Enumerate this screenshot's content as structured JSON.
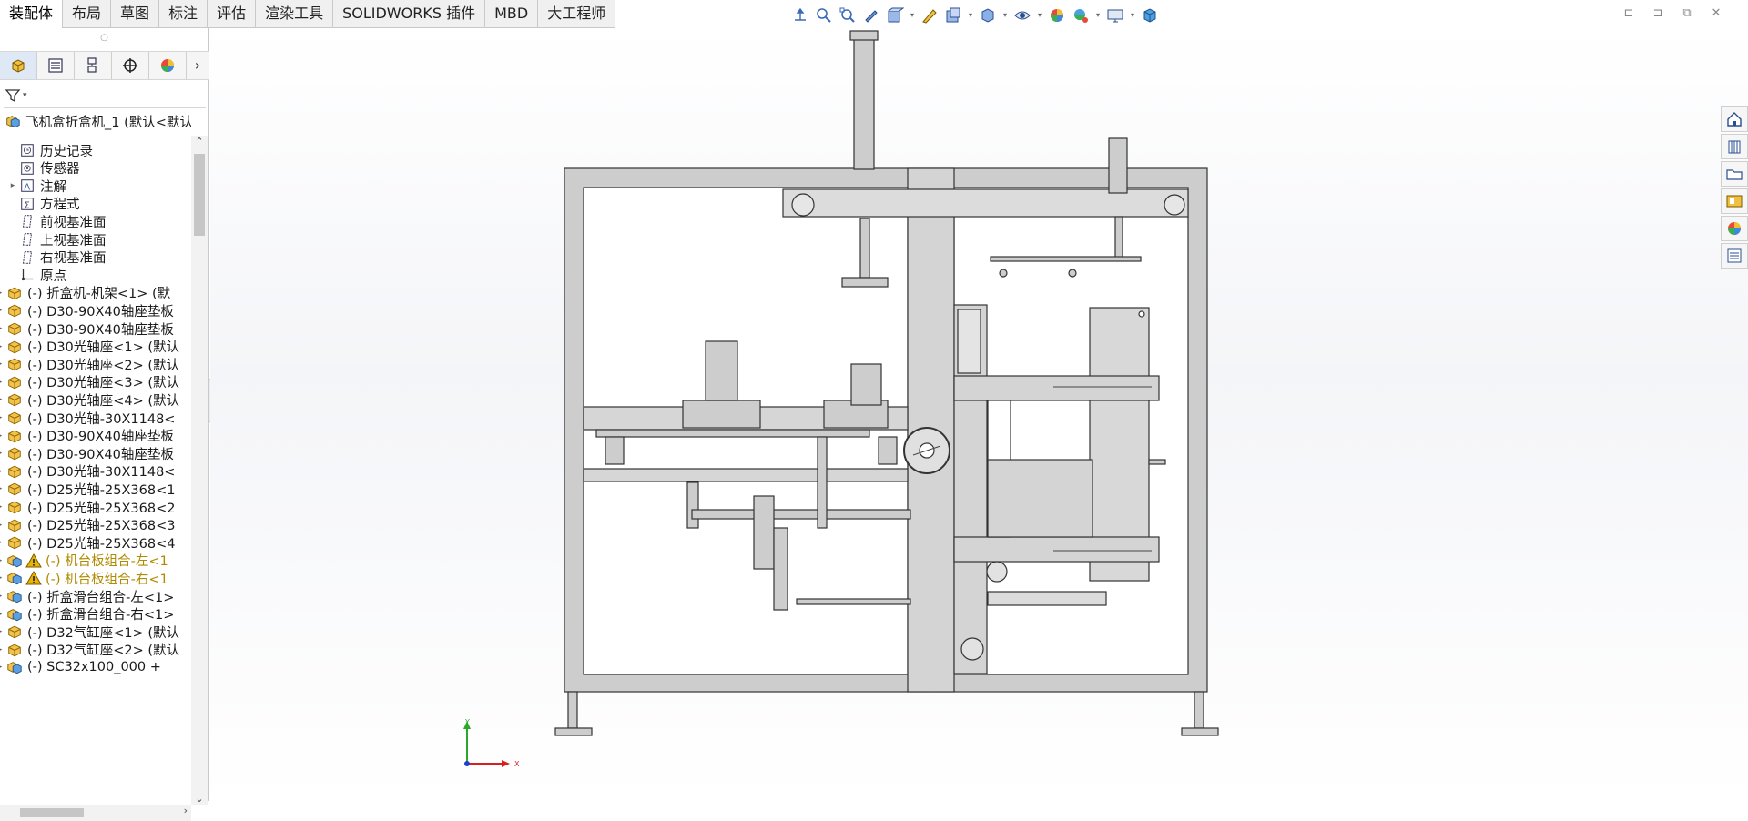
{
  "command_tabs": [
    "装配体",
    "布局",
    "草图",
    "标注",
    "评估",
    "渲染工具",
    "SOLIDWORKS 插件",
    "MBD",
    "大工程师"
  ],
  "active_tab": "装配体",
  "heads_up_toolbar": [
    "view-orientation-icon",
    "zoom-to-fit-icon",
    "zoom-area-icon",
    "previous-view-icon",
    "section-view-icon",
    "dynamic-annotation-icon",
    "view-settings-icon",
    "display-style-icon",
    "hide-show-icon",
    "edit-appearance-icon",
    "apply-scene-icon",
    "view-settings-monitor-icon",
    "3d-view-icon"
  ],
  "feature_tree": {
    "root": "飞机盒折盒机_1 (默认<默认",
    "items": [
      {
        "label": "历史记录",
        "icon": "history-icon",
        "expandable": false,
        "warning": false
      },
      {
        "label": "传感器",
        "icon": "sensor-icon",
        "expandable": false,
        "warning": false
      },
      {
        "label": "注解",
        "icon": "annotation-icon",
        "expandable": true,
        "warning": false
      },
      {
        "label": "方程式",
        "icon": "equation-icon",
        "expandable": false,
        "warning": false
      },
      {
        "label": "前视基准面",
        "icon": "plane-icon",
        "expandable": false,
        "warning": false
      },
      {
        "label": "上视基准面",
        "icon": "plane-icon",
        "expandable": false,
        "warning": false
      },
      {
        "label": "右视基准面",
        "icon": "plane-icon",
        "expandable": false,
        "warning": false
      },
      {
        "label": "原点",
        "icon": "origin-icon",
        "expandable": false,
        "warning": false
      },
      {
        "label": "(-) 折盒机-机架<1> (默",
        "icon": "part-icon",
        "expandable": true,
        "warning": false
      },
      {
        "label": "(-) D30-90X40轴座垫板",
        "icon": "part-icon",
        "expandable": true,
        "warning": false
      },
      {
        "label": "(-) D30-90X40轴座垫板",
        "icon": "part-icon",
        "expandable": true,
        "warning": false
      },
      {
        "label": "(-) D30光轴座<1> (默认",
        "icon": "part-icon",
        "expandable": true,
        "warning": false
      },
      {
        "label": "(-) D30光轴座<2> (默认",
        "icon": "part-icon",
        "expandable": true,
        "warning": false
      },
      {
        "label": "(-) D30光轴座<3> (默认",
        "icon": "part-icon",
        "expandable": true,
        "warning": false
      },
      {
        "label": "(-) D30光轴座<4> (默认",
        "icon": "part-icon",
        "expandable": true,
        "warning": false
      },
      {
        "label": "(-) D30光轴-30X1148<",
        "icon": "part-icon",
        "expandable": true,
        "warning": false
      },
      {
        "label": "(-) D30-90X40轴座垫板",
        "icon": "part-icon",
        "expandable": true,
        "warning": false
      },
      {
        "label": "(-) D30-90X40轴座垫板",
        "icon": "part-icon",
        "expandable": true,
        "warning": false
      },
      {
        "label": "(-) D30光轴-30X1148<",
        "icon": "part-icon",
        "expandable": true,
        "warning": false
      },
      {
        "label": "(-) D25光轴-25X368<1",
        "icon": "part-icon",
        "expandable": true,
        "warning": false
      },
      {
        "label": "(-) D25光轴-25X368<2",
        "icon": "part-icon",
        "expandable": true,
        "warning": false
      },
      {
        "label": "(-) D25光轴-25X368<3",
        "icon": "part-icon",
        "expandable": true,
        "warning": false
      },
      {
        "label": "(-) D25光轴-25X368<4",
        "icon": "part-icon",
        "expandable": true,
        "warning": false
      },
      {
        "label": "(-) 机台板组合-左<1",
        "icon": "assembly-icon",
        "expandable": true,
        "warning": true
      },
      {
        "label": "(-) 机台板组合-右<1",
        "icon": "assembly-icon",
        "expandable": true,
        "warning": true
      },
      {
        "label": "(-) 折盒滑台组合-左<1>",
        "icon": "assembly-icon",
        "expandable": true,
        "warning": false
      },
      {
        "label": "(-) 折盒滑台组合-右<1>",
        "icon": "assembly-icon",
        "expandable": true,
        "warning": false
      },
      {
        "label": "(-) D32气缸座<1> (默认",
        "icon": "part-icon",
        "expandable": true,
        "warning": false
      },
      {
        "label": "(-) D32气缸座<2> (默认",
        "icon": "part-icon",
        "expandable": true,
        "warning": false
      },
      {
        "label": "(-) SC32x100_000 +",
        "icon": "assembly-icon",
        "expandable": true,
        "warning": false
      }
    ]
  },
  "triad": {
    "y_label": "Y",
    "x_label": "X"
  },
  "task_pane": [
    "home-icon",
    "design-library-icon",
    "file-explorer-icon",
    "view-palette-icon",
    "appearances-icon",
    "custom-properties-icon"
  ],
  "colors": {
    "frame_fill": "#c8c8c8",
    "frame_stroke": "#3a3a3a",
    "warning": "#e8b400",
    "part_yellow": "#e9b43c",
    "axis_y": "#2aa82a",
    "axis_x": "#d62020",
    "axis_z": "#1f3fd0"
  }
}
